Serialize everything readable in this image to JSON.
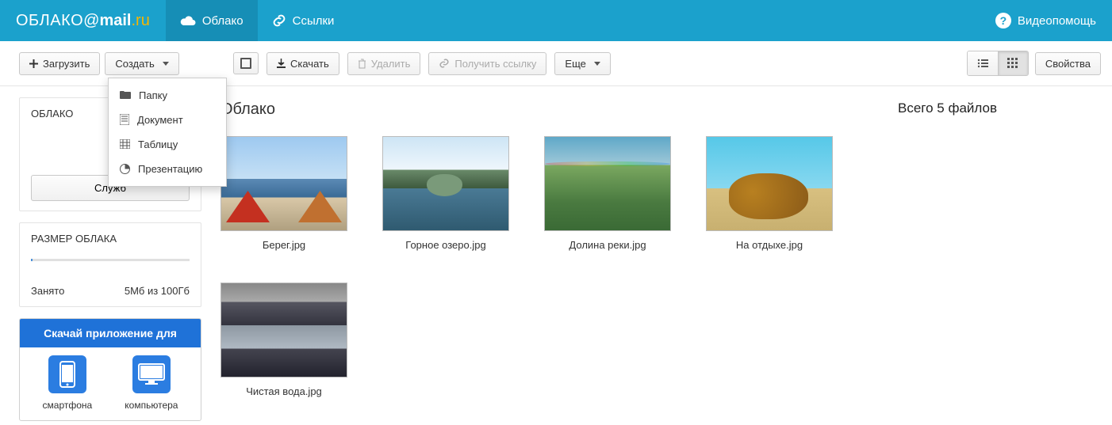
{
  "header": {
    "logo": {
      "text1": "ОБЛАКО",
      "at": "@",
      "mail": "mail",
      "dot": ".",
      "ru": "ru"
    },
    "nav": [
      {
        "label": "Облако",
        "active": true
      },
      {
        "label": "Ссылки",
        "active": false
      }
    ],
    "help": "Видеопомощь"
  },
  "toolbar": {
    "upload": "Загрузить",
    "create": "Создать",
    "download": "Скачать",
    "delete": "Удалить",
    "getlink": "Получить ссылку",
    "more": "Еще",
    "properties": "Свойства"
  },
  "create_menu": [
    {
      "icon": "folder-icon",
      "label": "Папку"
    },
    {
      "icon": "document-icon",
      "label": "Документ"
    },
    {
      "icon": "table-icon",
      "label": "Таблицу"
    },
    {
      "icon": "presentation-icon",
      "label": "Презентацию"
    }
  ],
  "sidebar": {
    "cloud_title": "ОБЛАКО",
    "service_btn": "Служб",
    "storage_title": "РАЗМЕР ОБЛАКА",
    "used_label": "Занято",
    "used_value": "5Мб из 100Гб",
    "promo_title": "Скачай приложение для",
    "promo_phone": "смартфона",
    "promo_pc": "компьютера"
  },
  "content": {
    "breadcrumb": "Облако",
    "files": [
      {
        "name": "Берег.jpg",
        "thumb": "thumb-beach"
      },
      {
        "name": "Горное озеро.jpg",
        "thumb": "thumb-lake"
      },
      {
        "name": "Долина реки.jpg",
        "thumb": "thumb-valley"
      },
      {
        "name": "На отдыхе.jpg",
        "thumb": "thumb-rest"
      },
      {
        "name": "Чистая вода.jpg",
        "thumb": "thumb-water"
      }
    ]
  },
  "rightpanel": {
    "summary": "Всего 5 файлов"
  }
}
